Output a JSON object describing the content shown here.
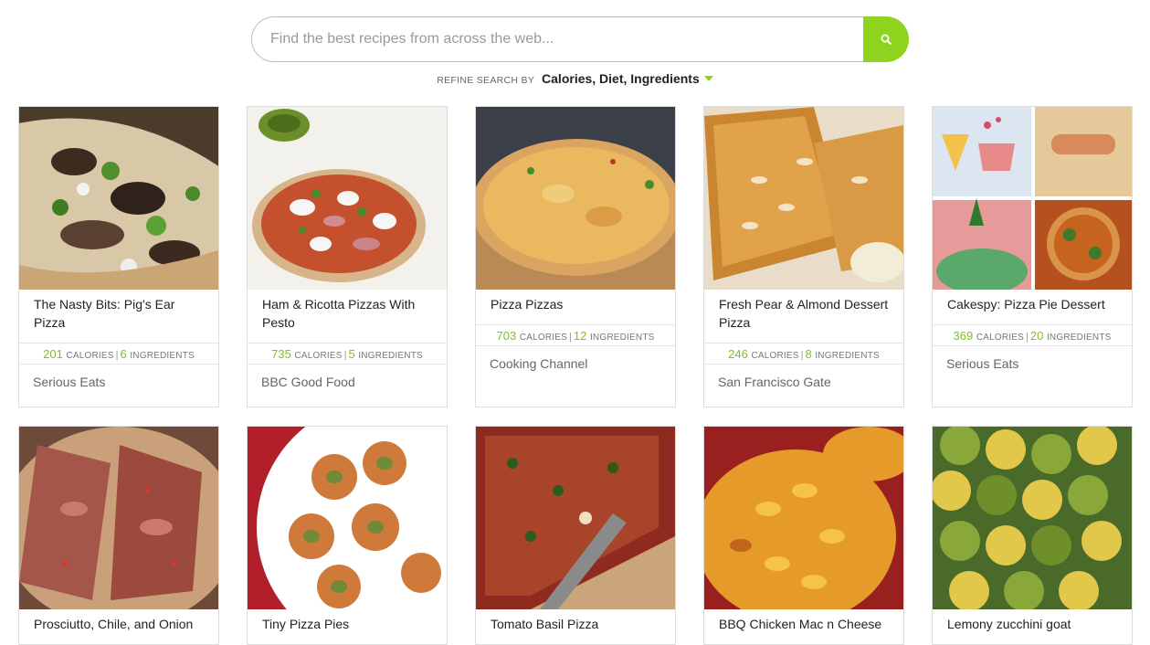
{
  "search": {
    "placeholder": "Find the best recipes from across the web...",
    "button_icon": "search-icon",
    "accent": "#8ed31e"
  },
  "refine": {
    "label": "REFINE SEARCH BY",
    "options": "Calories, Diet, Ingredients"
  },
  "stat_labels": {
    "calories": "CALORIES",
    "ingredients": "INGREDIENTS",
    "separator": "|"
  },
  "recipes": [
    {
      "title": "The Nasty Bits: Pig's Ear Pizza",
      "calories": "201",
      "ingredients": "6",
      "source": "Serious Eats"
    },
    {
      "title": "Ham & Ricotta Pizzas With Pesto",
      "calories": "735",
      "ingredients": "5",
      "source": "BBC Good Food"
    },
    {
      "title": "Pizza Pizzas",
      "calories": "703",
      "ingredients": "12",
      "source": "Cooking Channel"
    },
    {
      "title": "Fresh Pear & Almond Dessert Pizza",
      "calories": "246",
      "ingredients": "8",
      "source": "San Francisco Gate"
    },
    {
      "title": "Cakespy: Pizza Pie Dessert",
      "calories": "369",
      "ingredients": "20",
      "source": "Serious Eats"
    },
    {
      "title": "Prosciutto, Chile, and Onion"
    },
    {
      "title": "Tiny Pizza Pies"
    },
    {
      "title": "Tomato Basil Pizza"
    },
    {
      "title": "BBQ Chicken Mac n Cheese"
    },
    {
      "title": "Lemony zucchini goat"
    }
  ]
}
